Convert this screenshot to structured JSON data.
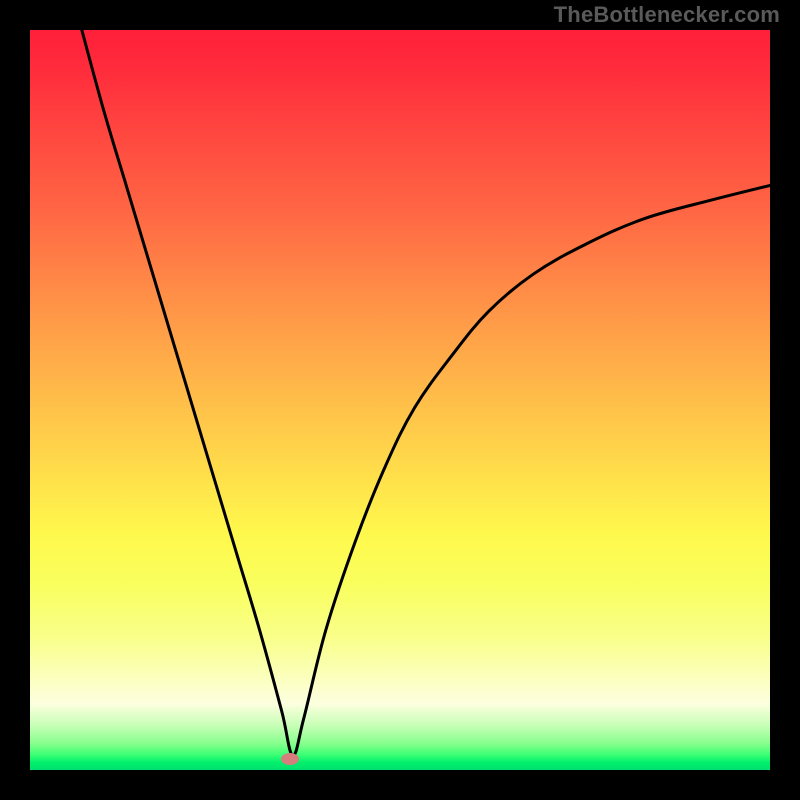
{
  "attribution": "TheBottlenecker.com",
  "colors": {
    "frame": "#000000",
    "attribution_text": "#5a5a5a",
    "curve": "#000000",
    "spot": "#d67d7d"
  },
  "chart_data": {
    "type": "line",
    "title": "",
    "xlabel": "",
    "ylabel": "",
    "xlim": [
      0,
      100
    ],
    "ylim": [
      0,
      100
    ],
    "series": [
      {
        "name": "bottleneck-curve",
        "x": [
          7,
          10,
          13,
          16,
          19,
          22,
          25,
          28,
          31,
          34,
          35.5,
          37,
          40,
          44,
          48,
          52,
          57,
          62,
          68,
          75,
          83,
          92,
          100
        ],
        "y": [
          100,
          89,
          79,
          69,
          59,
          49,
          39,
          29,
          19,
          8,
          2,
          7,
          19,
          31,
          41,
          49,
          56,
          62,
          67,
          71,
          74.5,
          77,
          79
        ]
      }
    ],
    "marker": {
      "x": 35.2,
      "y": 1.5
    },
    "background_gradient": {
      "type": "vertical",
      "stops": [
        {
          "pos": 0,
          "color": "#ff1f3a"
        },
        {
          "pos": 50,
          "color": "#ffb449"
        },
        {
          "pos": 75,
          "color": "#f9ff5e"
        },
        {
          "pos": 95,
          "color": "#84ff8c"
        },
        {
          "pos": 100,
          "color": "#00e070"
        }
      ]
    }
  }
}
